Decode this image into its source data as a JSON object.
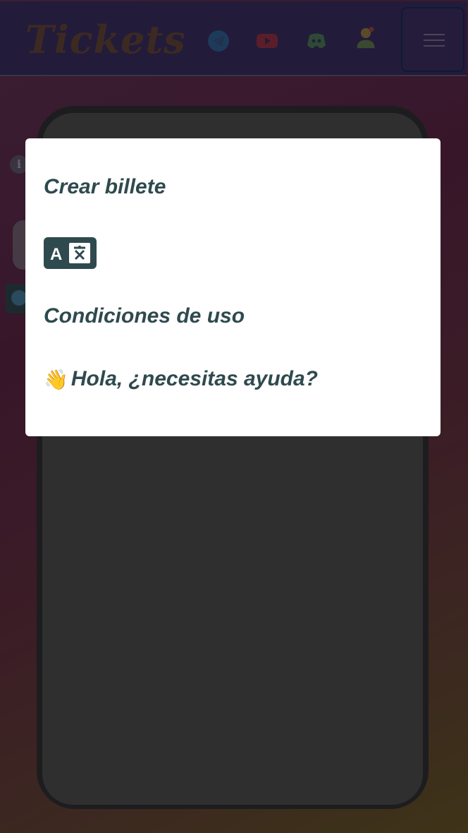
{
  "header": {
    "logo_text": "Tickets",
    "icons": [
      "telegram-icon",
      "youtube-icon",
      "discord-icon",
      "user-icon",
      "hamburger-menu-icon"
    ]
  },
  "menu": {
    "create_ticket": "Crear billete",
    "language_icon": "translate-icon",
    "terms": "Condiciones de uso",
    "help_emoji": "👋",
    "help": "Hola, ¿necesitas ayuda?"
  },
  "colors": {
    "header_bg": "#231b3a",
    "modal_bg": "#ffffff",
    "menu_text": "#2f4a4e",
    "phone_frame": "#1d1d1f",
    "phone_screen": "#2f2f2f"
  }
}
